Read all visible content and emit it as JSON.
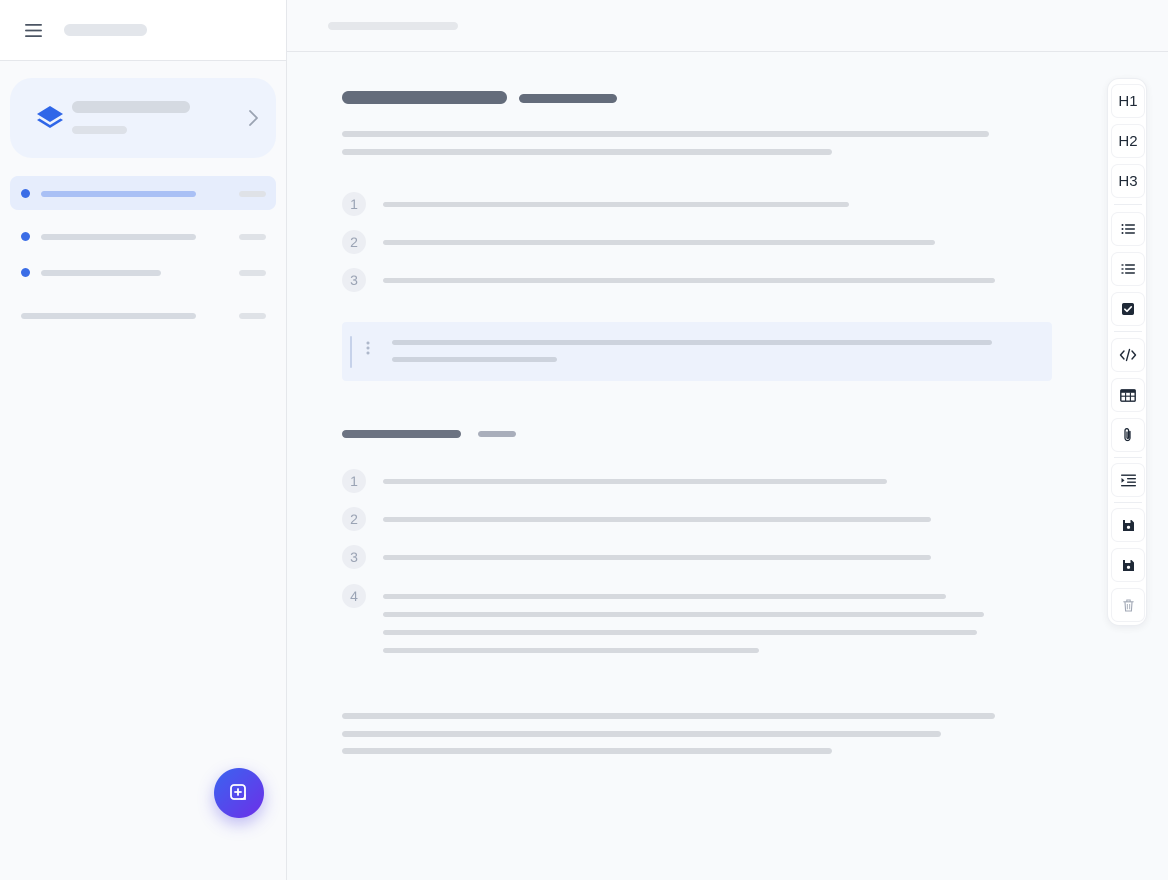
{
  "sidebar": {
    "nav_items": [
      {
        "active": true
      },
      {
        "active": false
      },
      {
        "active": false
      },
      {
        "active": false
      }
    ]
  },
  "document": {
    "list1": [
      "1",
      "2",
      "3"
    ],
    "list2": [
      "1",
      "2",
      "3",
      "4"
    ]
  },
  "toolbar": {
    "heading1": "H1",
    "heading2": "H2",
    "heading3": "H3",
    "icons": [
      "bullet-list-icon",
      "numbered-list-icon",
      "checkbox-icon",
      "code-icon",
      "table-icon",
      "attachment-icon",
      "indent-icon",
      "save-icon",
      "save-as-icon",
      "trash-icon"
    ]
  },
  "colors": {
    "accent": "#3b6de6",
    "fab_gradient_start": "#3a64f0",
    "fab_gradient_end": "#6d2fe8",
    "title_text_placeholder": "#646c7b",
    "body_text_placeholder": "#d6d9de"
  }
}
